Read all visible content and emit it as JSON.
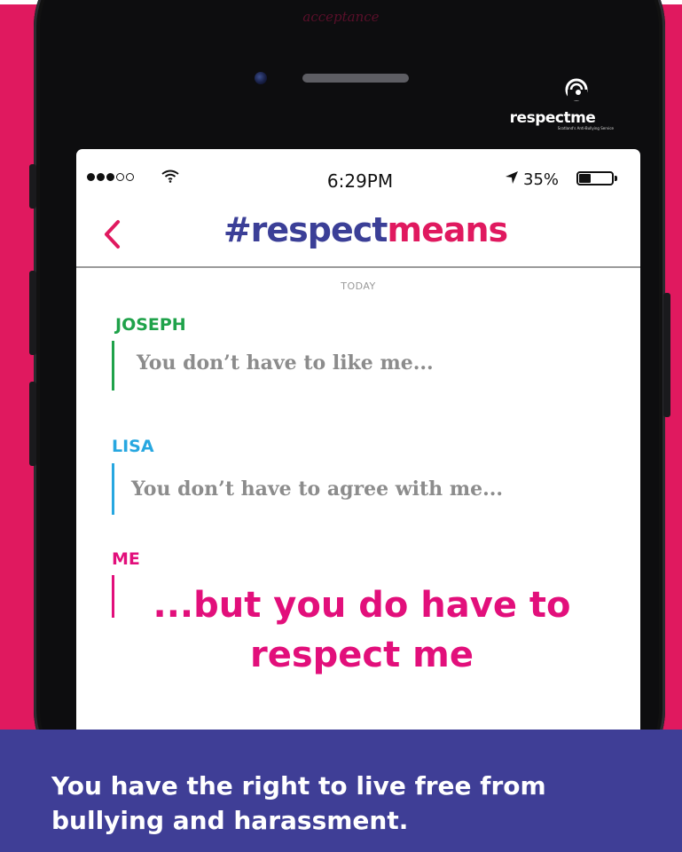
{
  "watermark": "acceptance",
  "brand": {
    "name": "respectme",
    "tagline": "Scotland's Anti-Bullying Service"
  },
  "status_bar": {
    "time": "6:29PM",
    "battery_percent": "35%",
    "battery_level": 0.35,
    "signal_bars_filled": 3,
    "signal_bars_total": 5
  },
  "nav": {
    "back_icon": "chevron-left-icon",
    "title_part1": "#respect",
    "title_part2": "means"
  },
  "conversation": {
    "day_label": "TODAY",
    "messages": [
      {
        "sender": "JOSEPH",
        "text": "You don’t have to like me...",
        "color": "#1fa24a"
      },
      {
        "sender": "LISA",
        "text": "You don’t have to agree with me...",
        "color": "#27a7e0"
      },
      {
        "sender": "ME",
        "text_line1": "...but you do have to",
        "text_line2": "respect me",
        "color": "#e20f7b"
      }
    ]
  },
  "banner": {
    "line1": "You have the right to live free from",
    "line2": "bullying and harassment."
  },
  "colors": {
    "pink": "#e0195f",
    "navy": "#3f3e96",
    "title_blue": "#3b3f97",
    "magenta": "#e20f7b"
  }
}
